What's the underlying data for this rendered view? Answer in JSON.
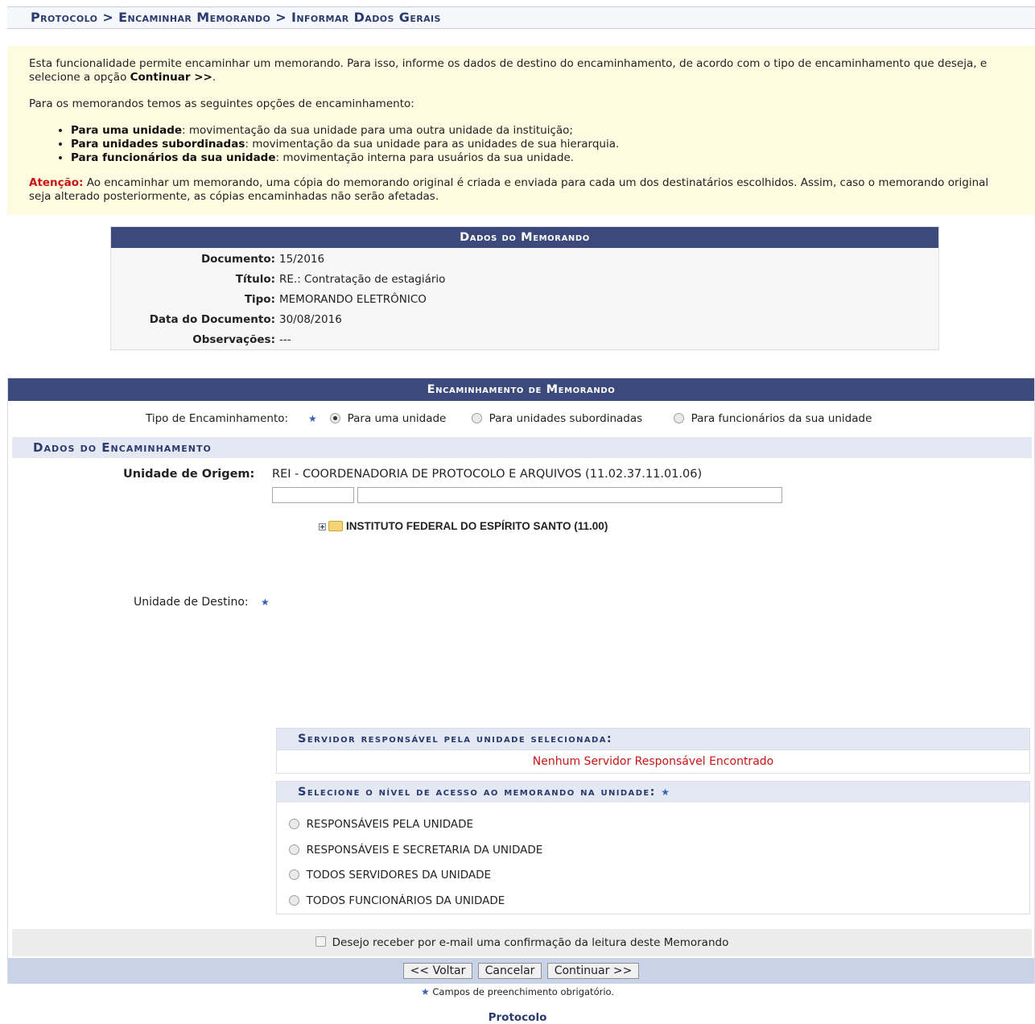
{
  "breadcrumb": "Protocolo > Encaminhar Memorando > Informar Dados Gerais",
  "info": {
    "intro_1": "Esta funcionalidade permite encaminhar um memorando. Para isso, informe os dados de destino do encaminhamento, de acordo com o tipo de encaminhamento que deseja, e selecione a opção ",
    "intro_bold": "Continuar >>",
    "intro_end": ".",
    "options_title": "Para os memorandos temos as seguintes opções de encaminhamento:",
    "bullets": [
      {
        "bold": "Para uma unidade",
        "text": ": movimentação da sua unidade para uma outra unidade da instituição;"
      },
      {
        "bold": "Para unidades subordinadas",
        "text": ": movimentação da sua unidade para as unidades de sua hierarquia."
      },
      {
        "bold": "Para funcionários da sua unidade",
        "text": ": movimentação interna para usuários da sua unidade."
      }
    ],
    "warn_label": "Atenção:",
    "warn_text": " Ao encaminhar um memorando, uma cópia do memorando original é criada e enviada para cada um dos destinatários escolhidos. Assim, caso o memorando original seja alterado posteriormente, as cópias encaminhadas não serão afetadas."
  },
  "memo": {
    "title": "Dados do Memorando",
    "fields": [
      {
        "label": "Documento:",
        "value": "15/2016"
      },
      {
        "label": "Título:",
        "value": "RE.: Contratação de estagiário"
      },
      {
        "label": "Tipo:",
        "value": "MEMORANDO ELETRÔNICO"
      },
      {
        "label": "Data do Documento:",
        "value": "30/08/2016"
      },
      {
        "label": "Observações:",
        "value": "---"
      }
    ]
  },
  "form": {
    "title": "Encaminhamento de Memorando",
    "tipo_label": "Tipo de Encaminhamento:",
    "tipo_options": [
      "Para uma unidade",
      "Para unidades subordinadas",
      "Para funcionários da sua unidade"
    ],
    "tipo_selected": 0,
    "dados_title": "Dados do Encaminhamento",
    "origem_label": "Unidade de Origem:",
    "origem_value": "REI - COORDENADORIA DE PROTOCOLO E ARQUIVOS (11.02.37.11.01.06)",
    "tree_root": "INSTITUTO FEDERAL DO ESPÍRITO SANTO (11.00)",
    "destino_label": "Unidade de Destino:",
    "servidor_title": "Servidor responsável pela unidade selecionada:",
    "servidor_empty": "Nenhum Servidor Responsável Encontrado",
    "nivel_title": "Selecione o nível de acesso ao memorando na unidade:",
    "nivel_options": [
      "RESPONSÁVEIS PELA UNIDADE",
      "RESPONSÁVEIS E SECRETARIA DA UNIDADE",
      "TODOS SERVIDORES DA UNIDADE",
      "TODOS FUNCIONÁRIOS DA UNIDADE"
    ],
    "email_label": "Desejo receber por e-mail uma confirmação da leitura deste Memorando",
    "buttons": {
      "voltar": "<< Voltar",
      "cancelar": "Cancelar",
      "continuar": "Continuar >>"
    }
  },
  "footnote": "Campos de preenchimento obrigatório.",
  "footer_link": "Protocolo",
  "colors": {
    "header_bg": "#3b4a7a",
    "warning": "#c81414",
    "info_bg": "#fdfbe0",
    "button_bar": "#c8d3e8"
  },
  "icons": [
    "star-icon",
    "plus-icon",
    "folder-icon"
  ]
}
